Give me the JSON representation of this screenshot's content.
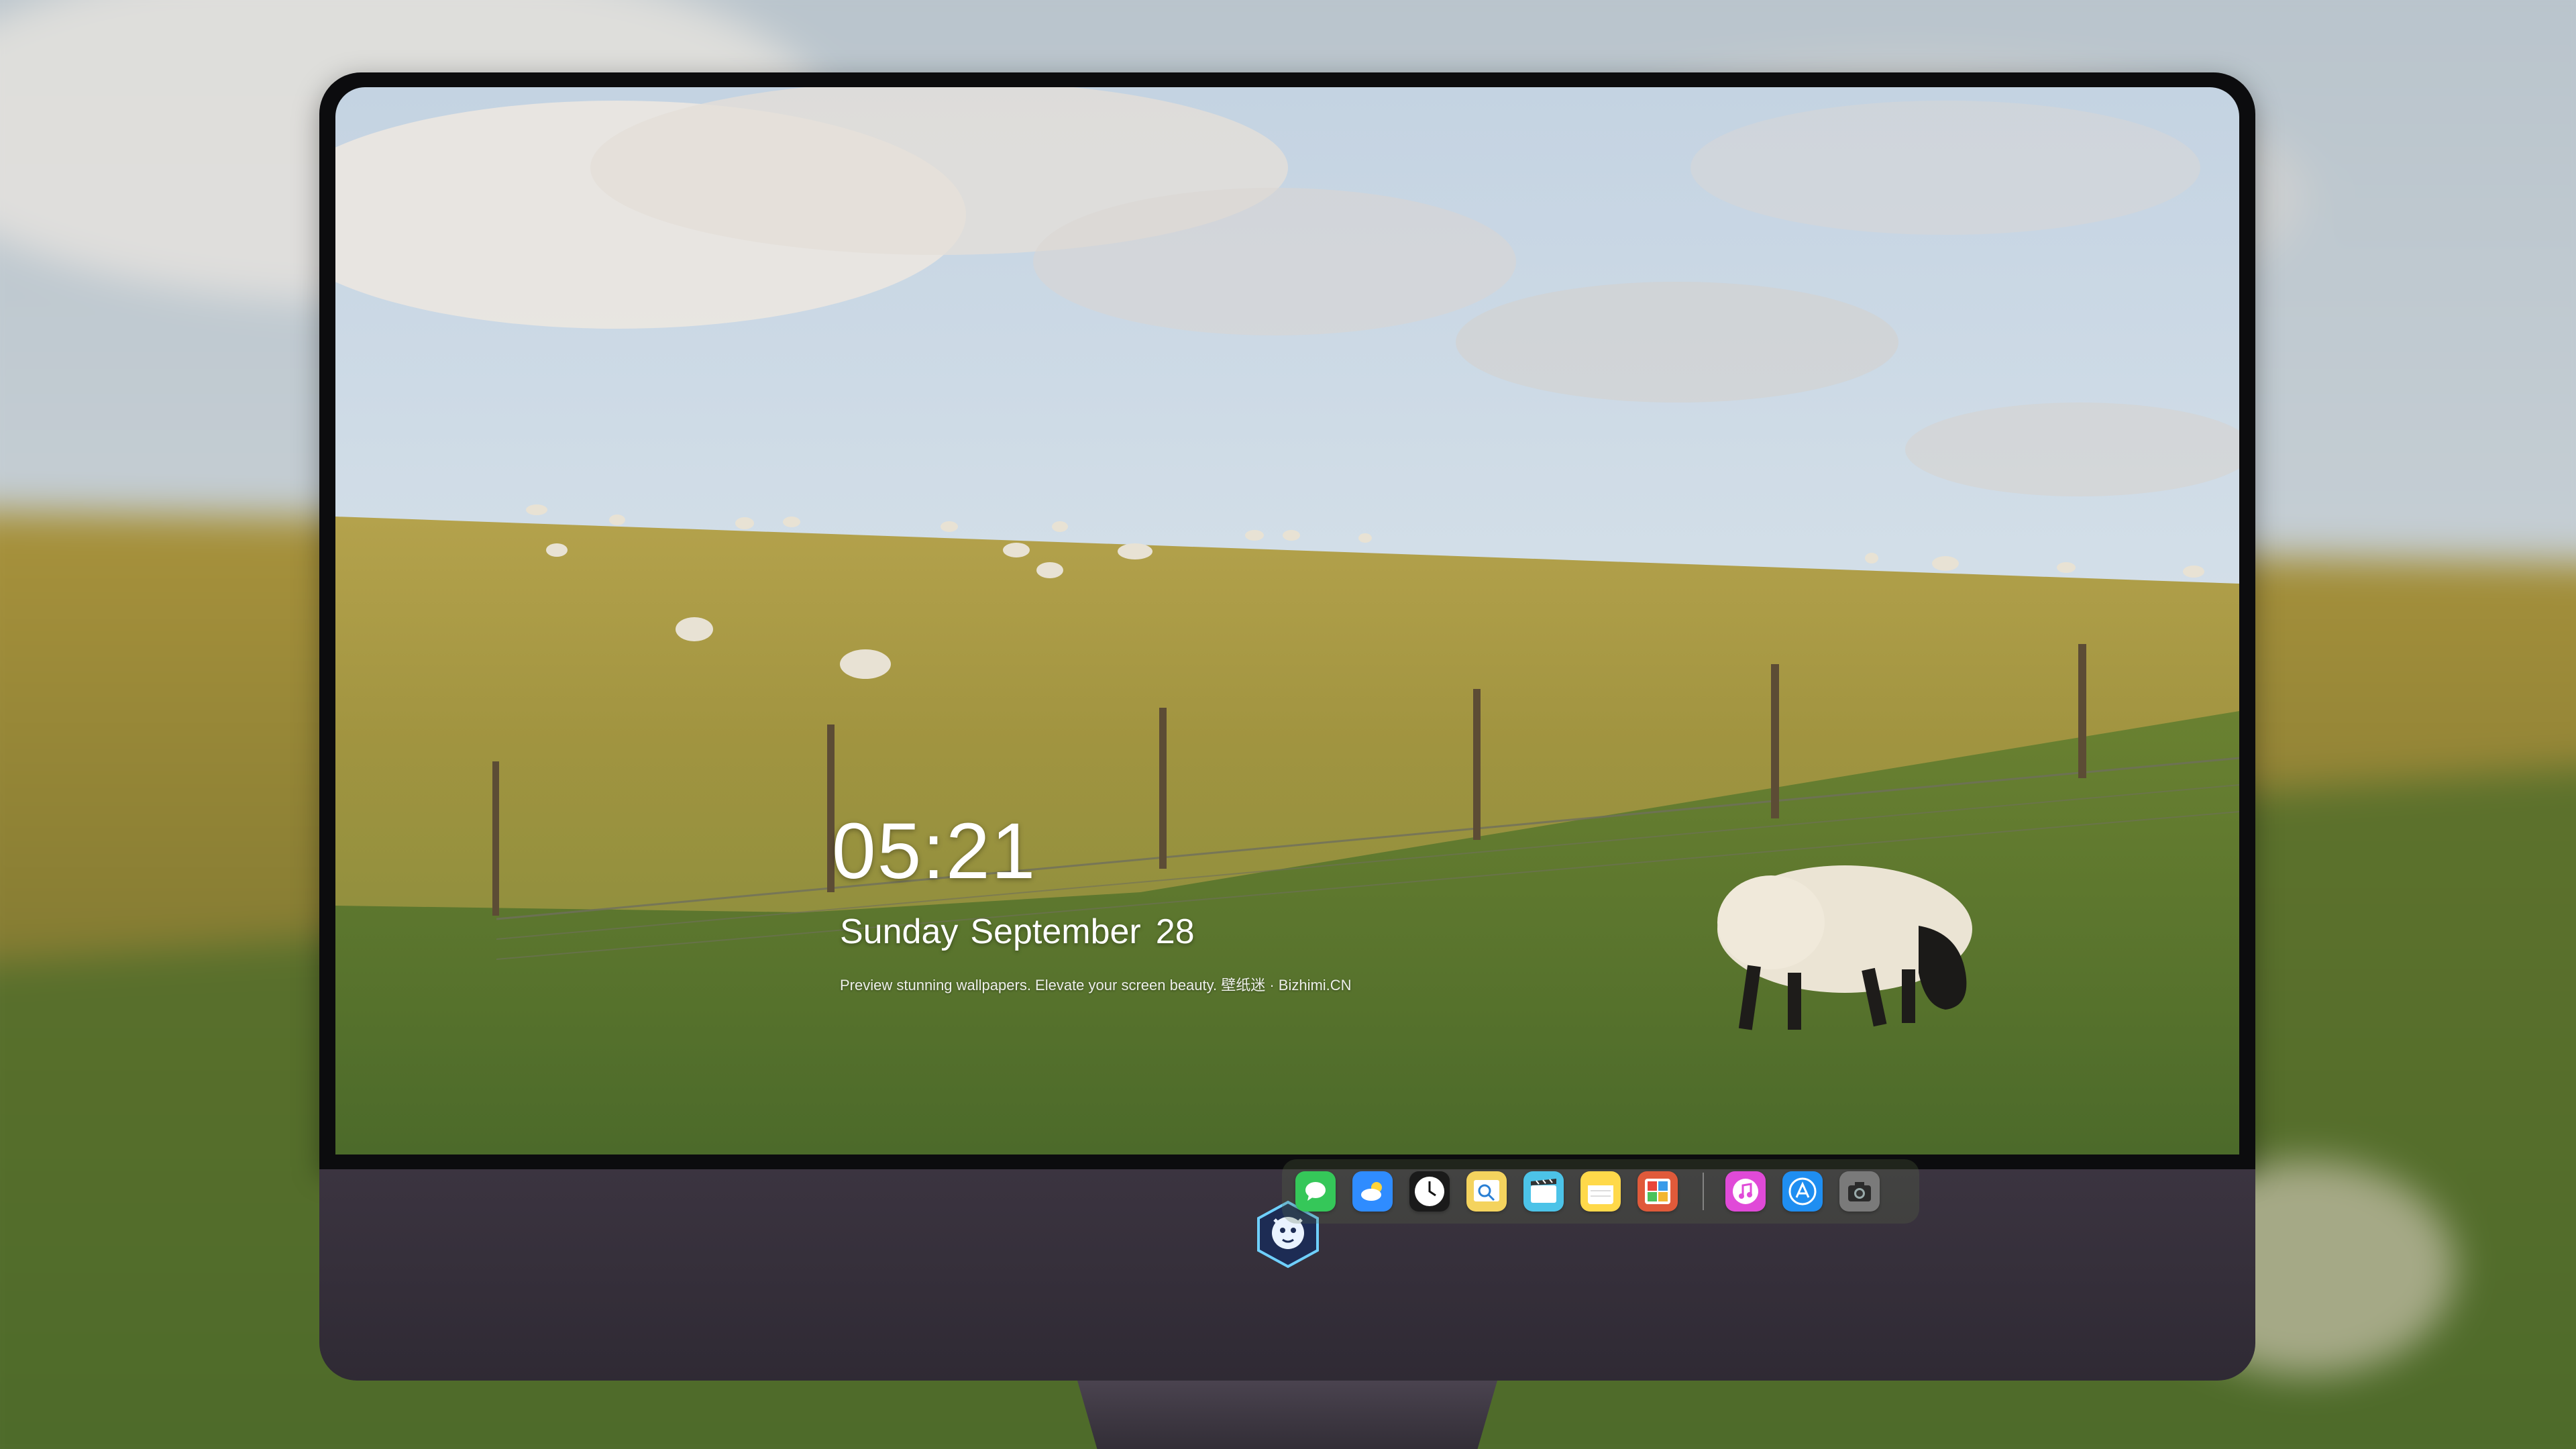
{
  "lockscreen": {
    "time": "05:21",
    "weekday": "Sunday",
    "month": "September",
    "day": "28",
    "tagline": "Preview stunning wallpapers. Elevate your screen beauty. 壁纸迷 · Bizhimi.CN"
  },
  "dock": {
    "apps": [
      {
        "name": "messages-icon",
        "color": "#35c759"
      },
      {
        "name": "weather-icon",
        "color": "#2f8cff"
      },
      {
        "name": "clock-icon",
        "color": "#1a1a1a"
      },
      {
        "name": "preview-icon",
        "color": "#f4d35e"
      },
      {
        "name": "final-cut-icon",
        "color": "#4cc3e8"
      },
      {
        "name": "notes-icon",
        "color": "#ffd94a"
      },
      {
        "name": "photo-booth-icon",
        "color": "#e05a3a"
      }
    ],
    "apps_right": [
      {
        "name": "itunes-icon",
        "color": "#e04ad8"
      },
      {
        "name": "app-store-icon",
        "color": "#1f8ef1"
      },
      {
        "name": "camera-icon",
        "color": "#7a7a7a"
      }
    ]
  },
  "colors": {
    "sky_top": "#c9d8e6",
    "sky_bottom": "#dfe9ef",
    "field_far": "#a89a45",
    "field_near": "#5f7b2e",
    "chin": "#34303a"
  }
}
